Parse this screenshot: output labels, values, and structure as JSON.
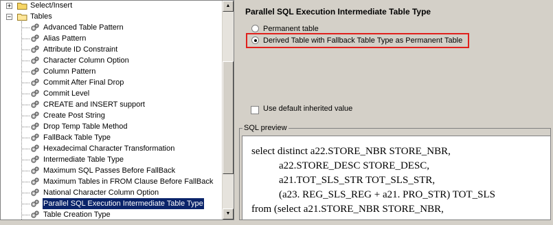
{
  "tree": {
    "items": [
      {
        "label": "Select/Insert",
        "kind": "folder",
        "expander": "+"
      },
      {
        "label": "Tables",
        "kind": "folder-open",
        "expander": "−"
      },
      {
        "label": "Advanced Table Pattern",
        "kind": "gear"
      },
      {
        "label": "Alias Pattern",
        "kind": "gear"
      },
      {
        "label": "Attribute ID Constraint",
        "kind": "gear"
      },
      {
        "label": "Character Column Option",
        "kind": "gear"
      },
      {
        "label": "Column Pattern",
        "kind": "gear"
      },
      {
        "label": "Commit After Final Drop",
        "kind": "gear"
      },
      {
        "label": "Commit Level",
        "kind": "gear"
      },
      {
        "label": "CREATE and INSERT support",
        "kind": "gear"
      },
      {
        "label": "Create Post String",
        "kind": "gear"
      },
      {
        "label": "Drop Temp Table Method",
        "kind": "gear"
      },
      {
        "label": "FallBack Table Type",
        "kind": "gear"
      },
      {
        "label": "Hexadecimal Character Transformation",
        "kind": "gear"
      },
      {
        "label": "Intermediate Table Type",
        "kind": "gear"
      },
      {
        "label": "Maximum SQL Passes Before FallBack",
        "kind": "gear"
      },
      {
        "label": "Maximum Tables in FROM Clause Before FallBack",
        "kind": "gear"
      },
      {
        "label": "National Character Column Option",
        "kind": "gear"
      },
      {
        "label": "Parallel SQL Execution Intermediate Table Type",
        "kind": "gear",
        "selected": true
      },
      {
        "label": "Table Creation Type",
        "kind": "gear"
      }
    ]
  },
  "property": {
    "title": "Parallel SQL Execution Intermediate Table Type",
    "options": [
      {
        "label": "Permanent table",
        "selected": false
      },
      {
        "label": "Derived Table with Fallback Table Type as Permanent Table",
        "selected": true
      }
    ],
    "use_default_label": "Use default inherited value",
    "use_default_checked": false
  },
  "sql_preview": {
    "legend": "SQL preview",
    "lines": [
      "select distinct a22.STORE_NBR STORE_NBR,",
      "a22.STORE_DESC STORE_DESC,",
      "a21.TOT_SLS_STR TOT_SLS_STR,",
      "(a23. REG_SLS_REG + a21. PRO_STR) TOT_SLS",
      "from (select a21.STORE_NBR STORE_NBR,"
    ]
  },
  "colors": {
    "highlight": "#e0201c",
    "selection": "#0a246a"
  }
}
